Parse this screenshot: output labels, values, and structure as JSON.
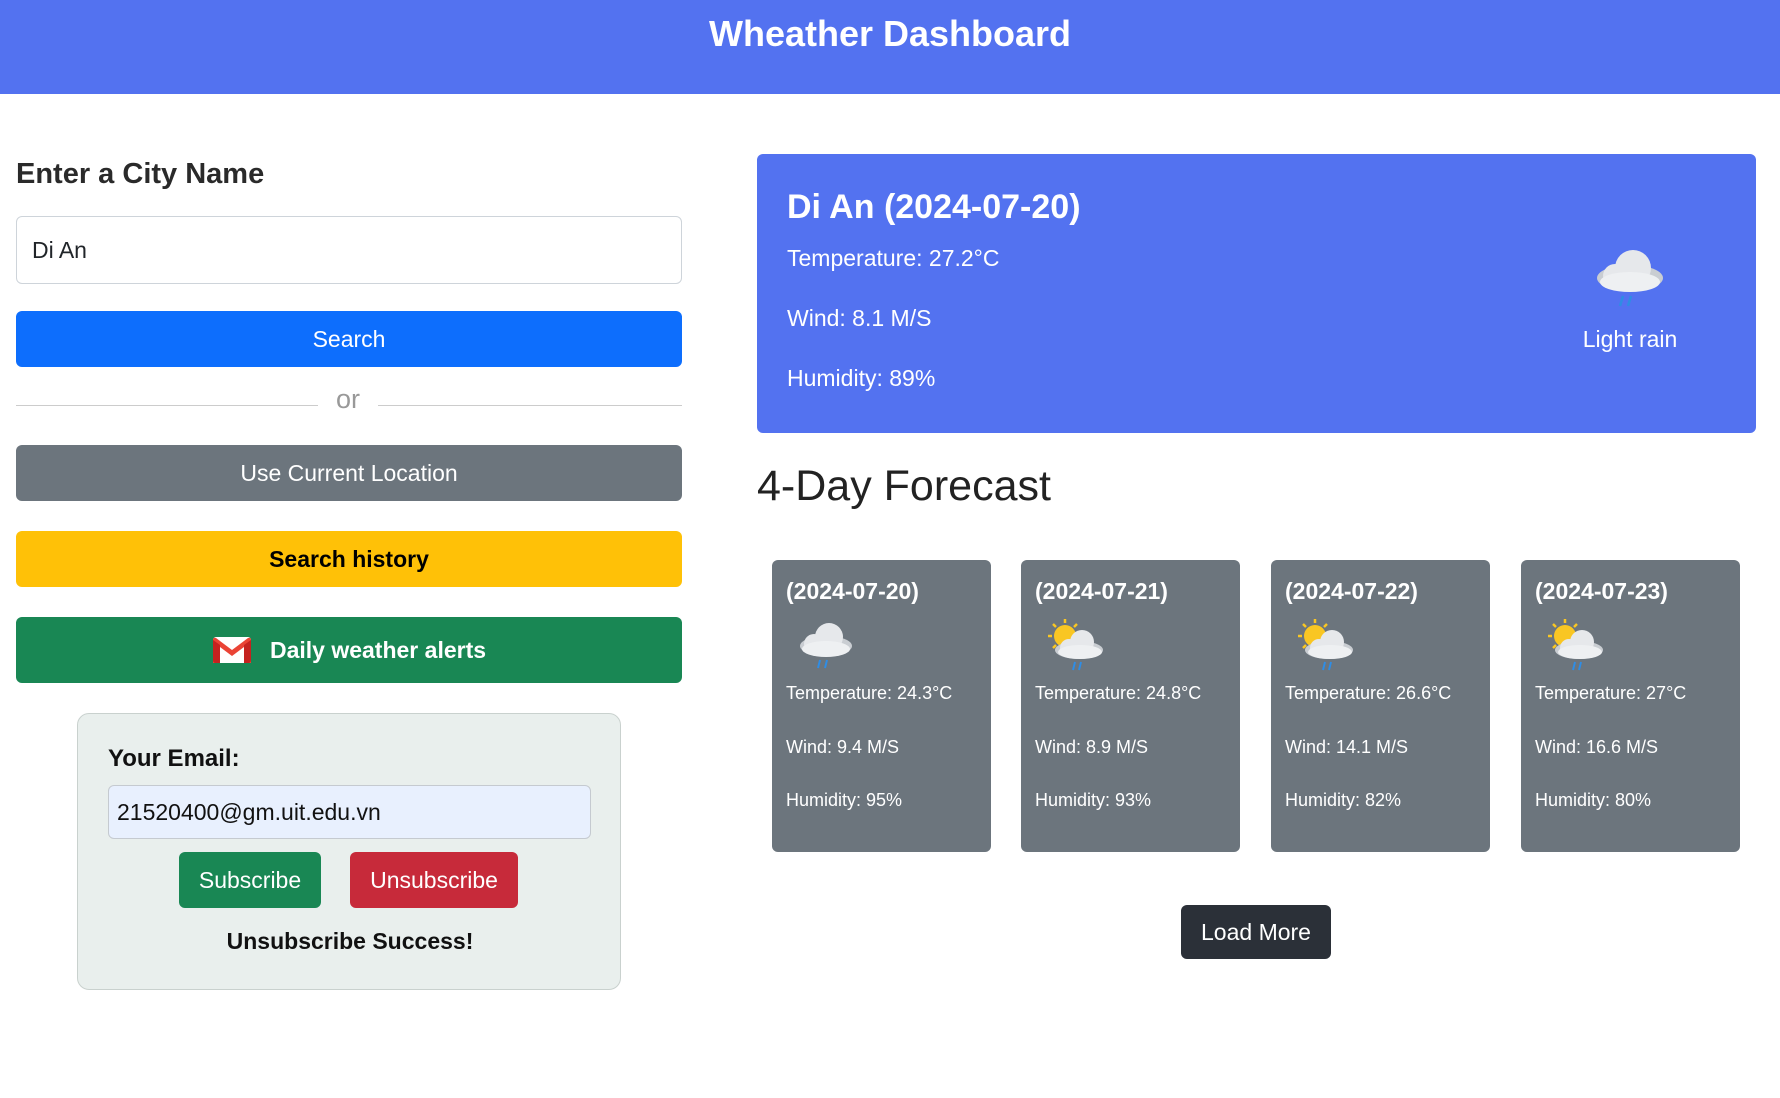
{
  "header": {
    "title": "Wheather Dashboard"
  },
  "search": {
    "label": "Enter a City Name",
    "value": "Di An",
    "search_button": "Search",
    "or_text": "or",
    "location_button": "Use Current Location",
    "history_button": "Search history",
    "alerts_button": "Daily weather alerts",
    "alerts_icon": "gmail-icon"
  },
  "email": {
    "label": "Your Email:",
    "value": "21520400@gm.uit.edu.vn",
    "subscribe_button": "Subscribe",
    "unsubscribe_button": "Unsubscribe",
    "status": "Unsubscribe Success!"
  },
  "current": {
    "title": "Di An (2024-07-20)",
    "temperature": "Temperature: 27.2°C",
    "wind": "Wind: 8.1 M/S",
    "humidity": "Humidity: 89%",
    "condition": "Light rain",
    "icon": "rain-cloud-icon"
  },
  "forecast": {
    "title": "4-Day Forecast",
    "days": [
      {
        "date": "(2024-07-20)",
        "icon": "rain-cloud-icon",
        "temperature": "Temperature: 24.3°C",
        "wind": "Wind: 9.4 M/S",
        "humidity": "Humidity: 95%"
      },
      {
        "date": "(2024-07-21)",
        "icon": "sun-cloud-rain-icon",
        "temperature": "Temperature: 24.8°C",
        "wind": "Wind: 8.9 M/S",
        "humidity": "Humidity: 93%"
      },
      {
        "date": "(2024-07-22)",
        "icon": "sun-cloud-rain-icon",
        "temperature": "Temperature: 26.6°C",
        "wind": "Wind: 14.1 M/S",
        "humidity": "Humidity: 82%"
      },
      {
        "date": "(2024-07-23)",
        "icon": "sun-cloud-rain-icon",
        "temperature": "Temperature: 27°C",
        "wind": "Wind: 16.6 M/S",
        "humidity": "Humidity: 80%"
      }
    ],
    "load_more_button": "Load More"
  },
  "colors": {
    "header_bg": "#5372f0",
    "primary": "#0d6efd",
    "secondary": "#6c757d",
    "warning": "#ffc107",
    "success": "#198754",
    "danger": "#c72a3a",
    "dark": "#2b3038"
  }
}
